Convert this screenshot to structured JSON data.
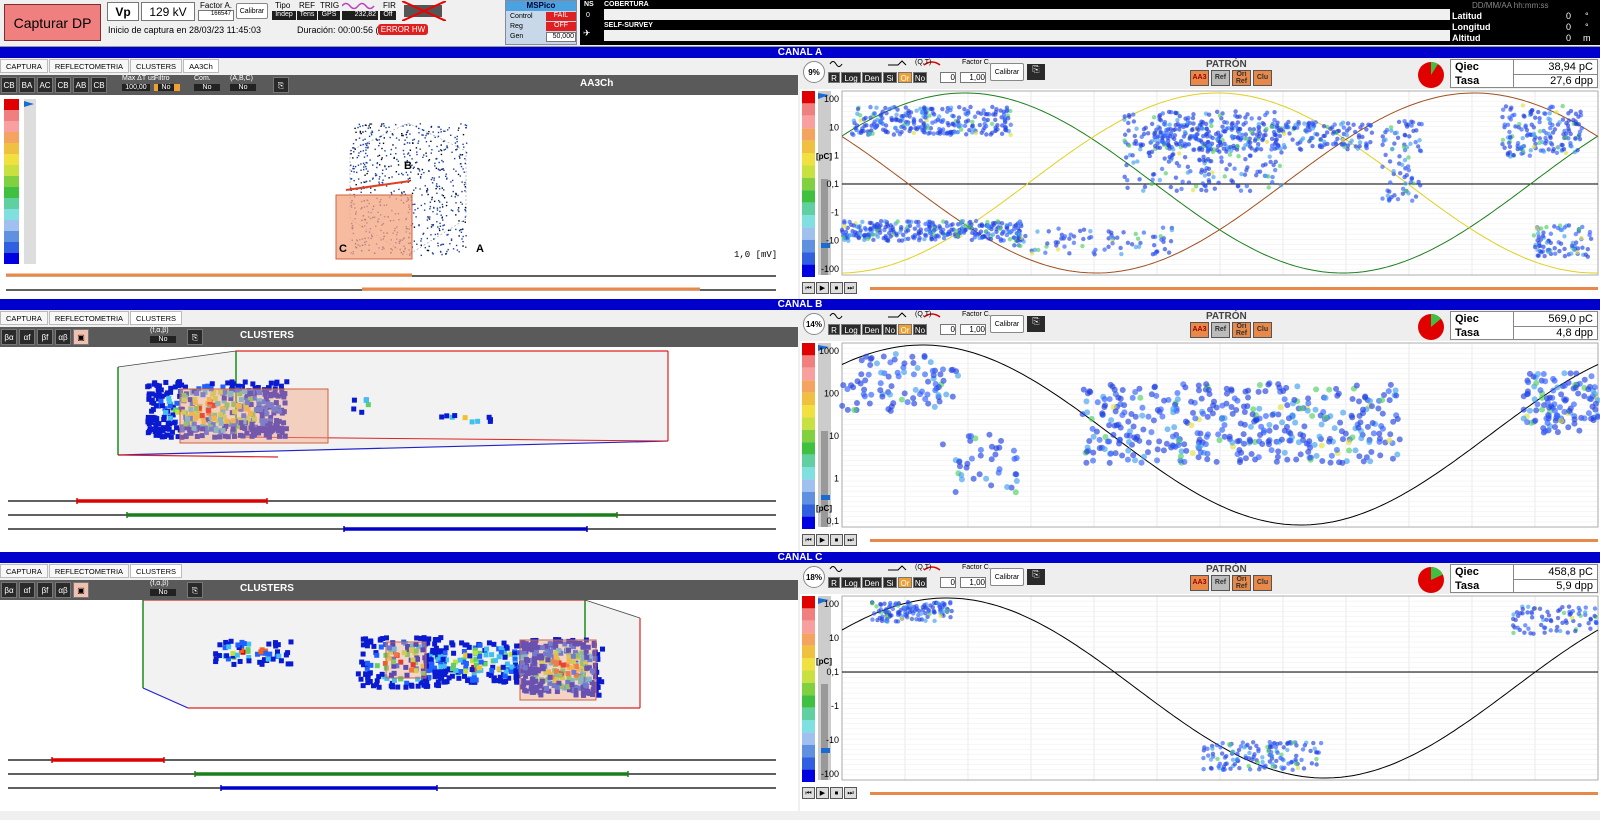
{
  "top": {
    "capture_label": "Capturar DP",
    "vp_label": "Vp",
    "vp_value": "129 kV",
    "factor_label": "Factor A.",
    "factor_value": "166547",
    "calibrate": "Calibrar",
    "tipo_label": "Tipo",
    "tipo_value": "Indep",
    "ref_label": "REF",
    "ref_value": "Tens",
    "trig_label": "TRIG",
    "trig_value": "GPS",
    "freq_value": "232,82",
    "fir_label": "FIR",
    "fir_value": "Off",
    "capture_start": "Inicio de captura en 28/03/23 11:45:03",
    "duration": "Duración: 00:00:56 (+0",
    "error": "ERROR HW",
    "mspico_title": "MSPico",
    "control_label": "Control",
    "control_value": "FAIL",
    "reg_label": "Reg",
    "reg_value": "OFF",
    "gen_label": "Gen",
    "gen_value": "50,000",
    "ns_label": "NS",
    "ns_value": "0",
    "cobertura": "COBERTURA",
    "self_survey": "SELF-SURVEY",
    "datetime": "DD/MM/AA hh:mm:ss",
    "latitud": "Latitud",
    "longitud": "Longitud",
    "altitud": "Altitud",
    "lat_val": "0",
    "lon_val": "0",
    "alt_val": "0",
    "lat_unit": "°",
    "lon_unit": "°",
    "alt_unit": "m"
  },
  "channels": [
    {
      "title": "CANAL A",
      "tabs": [
        "CAPTURA",
        "REFLECTOMETRIA",
        "CLUSTERS",
        "AA3Ch"
      ],
      "left_title": "AA3Ch",
      "toolbar_text": {
        "max": "Max ΔT us",
        "max_val": "100,00",
        "filtro": "Filtro",
        "filtro_val": "Si",
        "com": "Com.",
        "com_val": "No",
        "abc": "(A,B,C)",
        "abc_val": "No",
        "no": "No"
      },
      "left_scale": "1,0  [mV]",
      "axis_labels": [
        "A",
        "B",
        "C"
      ],
      "percent": "9%",
      "qiec_label": "Qiec",
      "qiec": "38,94 pC",
      "tasa_label": "Tasa",
      "tasa": "27,6 dpp",
      "patron": "PATRÓN",
      "yticks": [
        "100",
        "10",
        "1",
        "0,1",
        "-1",
        "-10",
        "-100"
      ],
      "unit": "[pC]",
      "buttons": [
        "R",
        "Log",
        "Den",
        "Si",
        "Or",
        "No"
      ],
      "factor_c": "Factor C.",
      "factor_c_val": "1,00",
      "zero": "0",
      "qt": "(Q,T)",
      "calibrate": "Calibrar",
      "pattern_buttons": [
        "AA3",
        "Ref",
        "Ori Ref",
        "Clu"
      ],
      "pie_fraction": 0.09
    },
    {
      "title": "CANAL B",
      "tabs": [
        "CAPTURA",
        "REFLECTOMETRIA",
        "CLUSTERS"
      ],
      "left_title": "CLUSTERS",
      "toolbar_text": {
        "tfb": "(f,α,β)",
        "no": "No"
      },
      "percent": "14%",
      "qiec_label": "Qiec",
      "qiec": "569,0 pC",
      "tasa_label": "Tasa",
      "tasa": "4,8 dpp",
      "patron": "PATRÓN",
      "yticks": [
        "1000",
        "100",
        "10",
        "1",
        "0,1"
      ],
      "unit": "[pC]",
      "buttons": [
        "R",
        "Log",
        "Den",
        "No",
        "Or",
        "No"
      ],
      "factor_c": "Factor C.",
      "factor_c_val": "1,00",
      "zero": "0",
      "qt": "(Q,T)",
      "calibrate": "Calibrar",
      "pattern_buttons": [
        "AA3",
        "Ref",
        "Ori Ref",
        "Clu"
      ],
      "pie_fraction": 0.14
    },
    {
      "title": "CANAL C",
      "tabs": [
        "CAPTURA",
        "REFLECTOMETRIA",
        "CLUSTERS"
      ],
      "left_title": "CLUSTERS",
      "toolbar_text": {
        "tfb": "(f,α,β)",
        "no": "No"
      },
      "percent": "18%",
      "qiec_label": "Qiec",
      "qiec": "458,8 pC",
      "tasa_label": "Tasa",
      "tasa": "5,9 dpp",
      "patron": "PATRÓN",
      "yticks": [
        "100",
        "10",
        "0,1",
        "-1",
        "-10",
        "-100"
      ],
      "unit": "[pC]",
      "buttons": [
        "R",
        "Log",
        "Den",
        "Si",
        "Or",
        "No"
      ],
      "factor_c": "Factor C.",
      "factor_c_val": "1,00",
      "zero": "0",
      "qt": "(Q,T)",
      "calibrate": "Calibrar",
      "pattern_buttons": [
        "AA3",
        "Ref",
        "Ori Ref",
        "Clu"
      ],
      "pie_fraction": 0.18
    }
  ],
  "colors": {
    "channel_bar": "#0000cc",
    "accent_orange": "#e8894a",
    "red": "#dd0000",
    "green": "#1a7f1a",
    "blue": "#0000cc"
  }
}
